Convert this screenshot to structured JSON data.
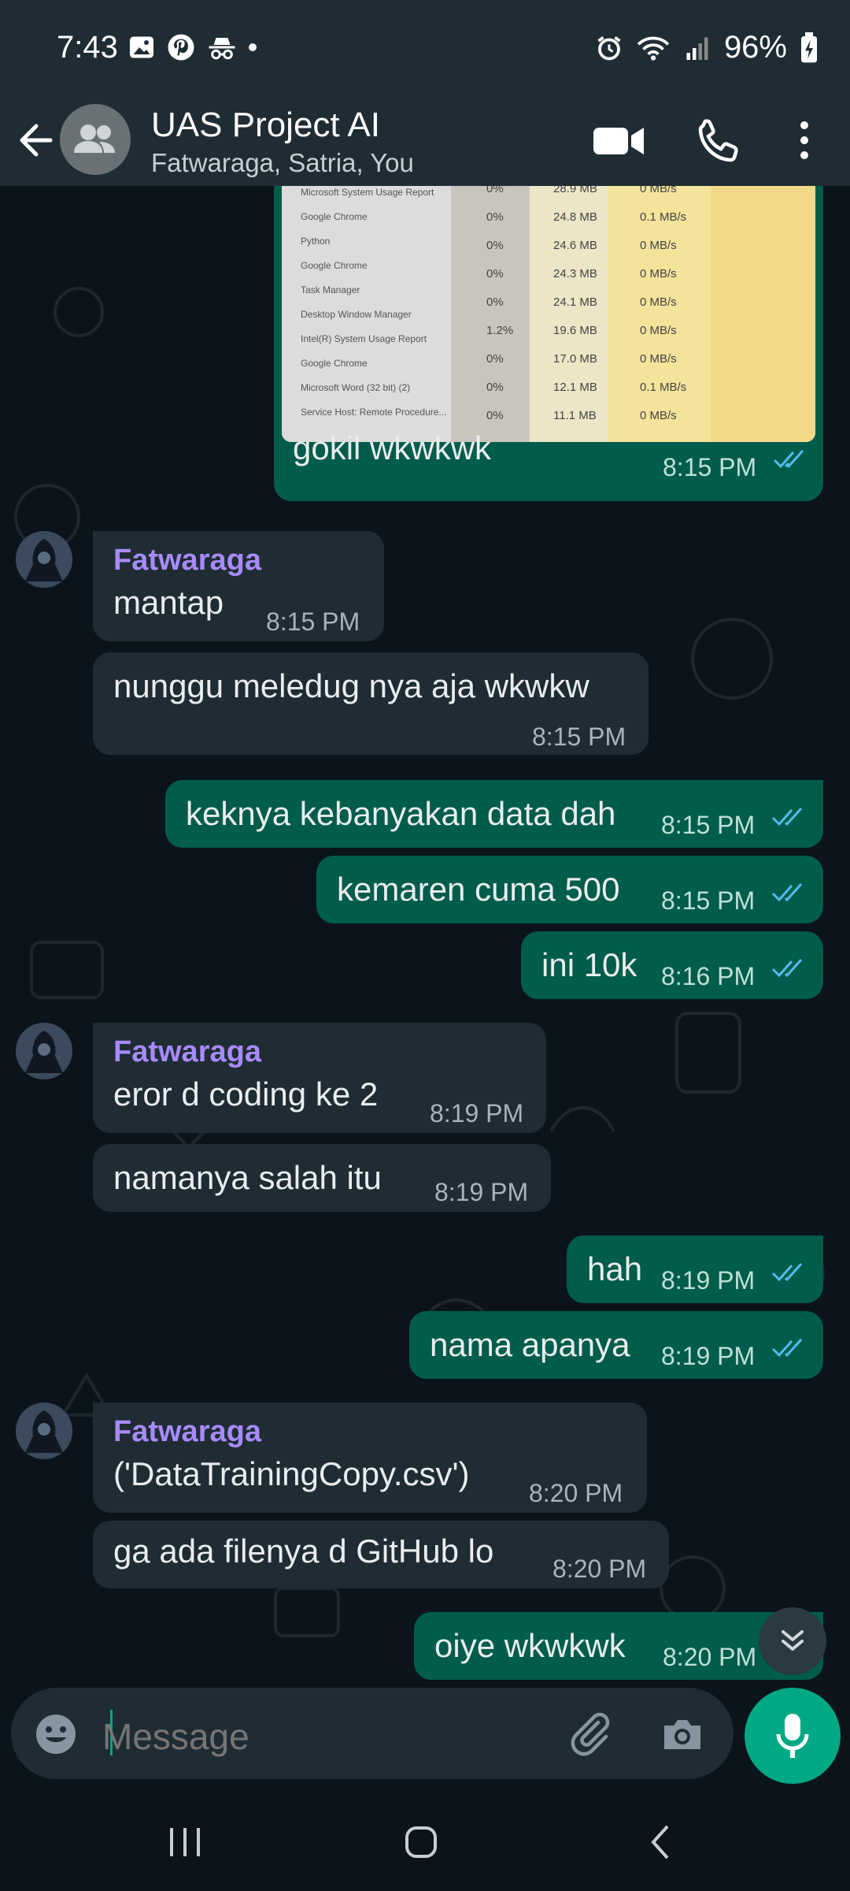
{
  "status_bar": {
    "time": "7:43",
    "battery": "96%"
  },
  "header": {
    "title": "UAS Project AI",
    "subtitle": "Fatwaraga, Satria, You"
  },
  "screenshot_rows": [
    {
      "pct": "0%",
      "mem": "28.9 MB",
      "disk": "0 MB/s"
    },
    {
      "pct": "0%",
      "mem": "24.8 MB",
      "disk": "0.1 MB/s"
    },
    {
      "pct": "0%",
      "mem": "24.6 MB",
      "disk": "0 MB/s"
    },
    {
      "pct": "0%",
      "mem": "24.3 MB",
      "disk": "0 MB/s"
    },
    {
      "pct": "0%",
      "mem": "24.1 MB",
      "disk": "0 MB/s"
    },
    {
      "pct": "1.2%",
      "mem": "19.6 MB",
      "disk": "0 MB/s"
    },
    {
      "pct": "0%",
      "mem": "17.0 MB",
      "disk": "0 MB/s"
    },
    {
      "pct": "0%",
      "mem": "12.1 MB",
      "disk": "0.1 MB/s"
    },
    {
      "pct": "0%",
      "mem": "11.1 MB",
      "disk": "0 MB/s"
    }
  ],
  "screenshot_names": [
    "Microsoft System Usage Report",
    "Google Chrome",
    "Python",
    "Google Chrome",
    "Task Manager",
    "Desktop Window Manager",
    "Intel(R) System Usage Report",
    "Google Chrome",
    "Microsoft Word (32 bit) (2)",
    "Service Host: Remote Procedure..."
  ],
  "messages": [
    {
      "dir": "out",
      "text": "gokil wkwkwk",
      "time": "8:15 PM"
    },
    {
      "dir": "in",
      "sender": "Fatwaraga",
      "text": "mantap",
      "time": "8:15 PM"
    },
    {
      "dir": "in",
      "text": "nunggu meledug nya aja wkwkw",
      "time": "8:15 PM"
    },
    {
      "dir": "out",
      "text": "keknya kebanyakan data dah",
      "time": "8:15 PM"
    },
    {
      "dir": "out",
      "text": "kemaren cuma 500",
      "time": "8:15 PM"
    },
    {
      "dir": "out",
      "text": "ini 10k",
      "time": "8:16 PM"
    },
    {
      "dir": "in",
      "sender": "Fatwaraga",
      "text": "eror d coding ke 2",
      "time": "8:19 PM"
    },
    {
      "dir": "in",
      "text": "namanya salah itu",
      "time": "8:19 PM"
    },
    {
      "dir": "out",
      "text": "hah",
      "time": "8:19 PM"
    },
    {
      "dir": "out",
      "text": "nama apanya",
      "time": "8:19 PM"
    },
    {
      "dir": "in",
      "sender": "Fatwaraga",
      "text": "('DataTrainingCopy.csv')",
      "time": "8:20 PM"
    },
    {
      "dir": "in",
      "text": "ga ada filenya d GitHub lo",
      "time": "8:20 PM"
    },
    {
      "dir": "out",
      "text": "oiye wkwkwk",
      "time": "8:20 PM"
    }
  ],
  "input": {
    "placeholder": "Message"
  },
  "colors": {
    "outgoing_bubble": "#005c4b",
    "incoming_bubble": "#1f2c34",
    "sender_name": "#a78bfa",
    "accent": "#00a884",
    "read_ticks": "#53bdeb"
  },
  "icons": {
    "back": "arrow-left-icon",
    "group_avatar": "group-icon",
    "video": "video-call-icon",
    "call": "phone-icon",
    "menu": "more-vert-icon",
    "emoji": "emoji-icon",
    "attach": "paperclip-icon",
    "camera": "camera-icon",
    "mic": "mic-icon",
    "scroll_down": "double-chevron-down-icon"
  }
}
